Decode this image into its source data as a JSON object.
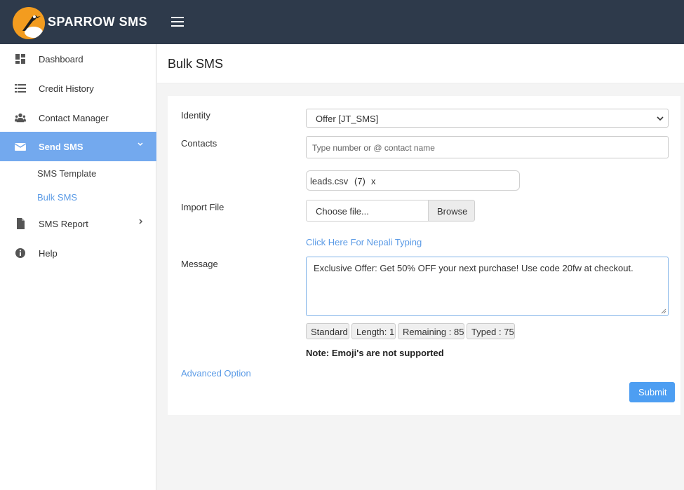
{
  "brand": {
    "name": "SPARROW SMS"
  },
  "sidebar": {
    "items": [
      {
        "label": "Dashboard",
        "icon": "dashboard-icon"
      },
      {
        "label": "Credit History",
        "icon": "list-icon"
      },
      {
        "label": "Contact Manager",
        "icon": "users-icon"
      },
      {
        "label": "Send SMS",
        "icon": "envelope-icon",
        "active": true,
        "children": [
          {
            "label": "SMS Template"
          },
          {
            "label": "Bulk SMS",
            "current": true
          }
        ]
      },
      {
        "label": "SMS Report",
        "icon": "file-icon"
      },
      {
        "label": "Help",
        "icon": "info-icon"
      }
    ]
  },
  "page": {
    "title": "Bulk SMS"
  },
  "form": {
    "identity_label": "Identity",
    "identity_value": "Offer [JT_SMS]",
    "contacts_label": "Contacts",
    "contacts_placeholder": "Type number or @ contact name",
    "file_chip": {
      "name": "leads.csv",
      "count": "(7)",
      "remove": "x"
    },
    "import_label": "Import File",
    "file_input_text": "Choose file...",
    "browse_label": "Browse",
    "nepali_link": "Click Here For Nepali Typing",
    "message_label": "Message",
    "message_value": "Exclusive Offer: Get 50% OFF your next purchase! Use code 20fw at checkout.",
    "stats": {
      "type": "Standard",
      "length": "Length: 1",
      "remaining": "Remaining : 85",
      "typed": "Typed : 75"
    },
    "note": "Note: Emoji's are not supported",
    "advanced_link": "Advanced Option",
    "submit_label": "Submit"
  },
  "colors": {
    "topbar": "#2e3a4b",
    "accent": "#73a9ee",
    "link": "#5b9be6",
    "submit": "#4d9ef2",
    "logo": "#f39c1f"
  }
}
